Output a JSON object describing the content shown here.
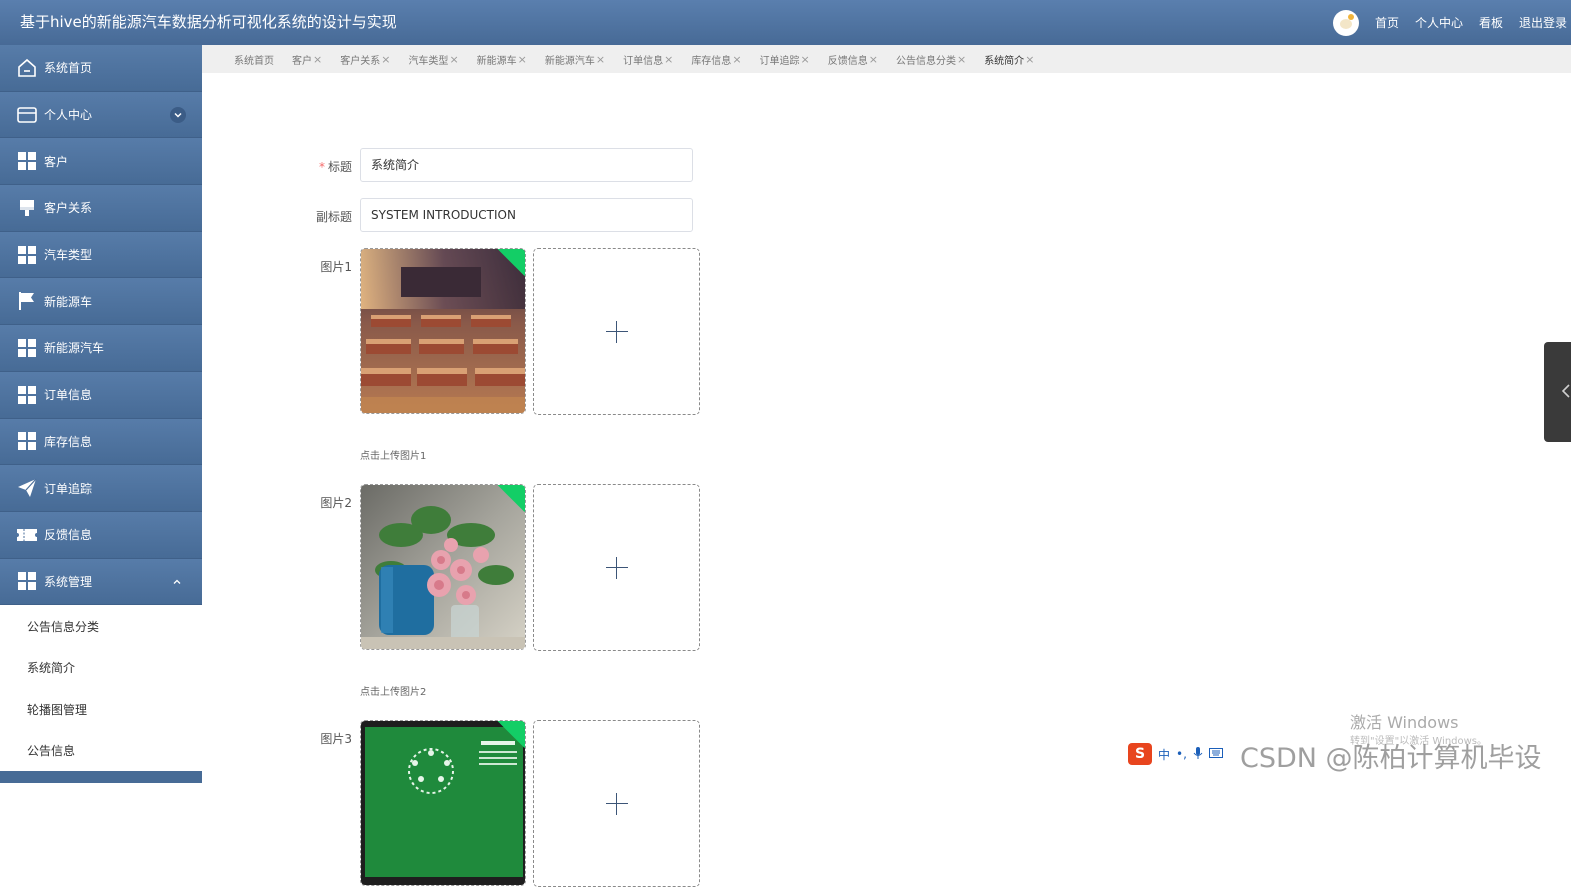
{
  "header": {
    "title": "基于hive的新能源汽车数据分析可视化系统的设计与实现",
    "links": [
      "首页",
      "个人中心",
      "看板",
      "退出登录"
    ]
  },
  "sidebar": {
    "items": [
      {
        "label": "系统首页",
        "icon": "home-icon"
      },
      {
        "label": "个人中心",
        "icon": "card-icon"
      },
      {
        "label": "客户",
        "icon": "grid-icon"
      },
      {
        "label": "客户关系",
        "icon": "brush-icon"
      },
      {
        "label": "汽车类型",
        "icon": "grid-icon"
      },
      {
        "label": "新能源车",
        "icon": "flag-icon"
      },
      {
        "label": "新能源汽车",
        "icon": "grid-icon"
      },
      {
        "label": "订单信息",
        "icon": "grid-icon"
      },
      {
        "label": "库存信息",
        "icon": "grid-icon"
      },
      {
        "label": "订单追踪",
        "icon": "send-icon"
      },
      {
        "label": "反馈信息",
        "icon": "ticket-icon"
      },
      {
        "label": "系统管理",
        "icon": "grid-icon"
      }
    ],
    "submenu": [
      "公告信息分类",
      "系统简介",
      "轮播图管理",
      "公告信息"
    ]
  },
  "tabs": [
    "系统首页",
    "客户",
    "客户关系",
    "汽车类型",
    "新能源车",
    "新能源汽车",
    "订单信息",
    "库存信息",
    "订单追踪",
    "反馈信息",
    "公告信息分类",
    "系统简介"
  ],
  "tab_close": "×",
  "form": {
    "title_label": "标题",
    "required_mark": "*",
    "title_value": "系统简介",
    "subtitle_label": "副标题",
    "subtitle_value": "SYSTEM INTRODUCTION",
    "pic1_label": "图片1",
    "pic1_hint": "点击上传图片1",
    "pic2_label": "图片2",
    "pic2_hint": "点击上传图片2",
    "pic3_label": "图片3"
  },
  "overlay": {
    "windows_activate": "激活 Windows",
    "windows_activate_sub": "转到\"设置\"以激活 Windows。",
    "csdn_watermark": "CSDN @陈柏计算机毕设",
    "ime_label": "中"
  },
  "colors": {
    "header": "#4f74a2",
    "accent_green": "#13ce66",
    "required_red": "#f56c6c"
  }
}
